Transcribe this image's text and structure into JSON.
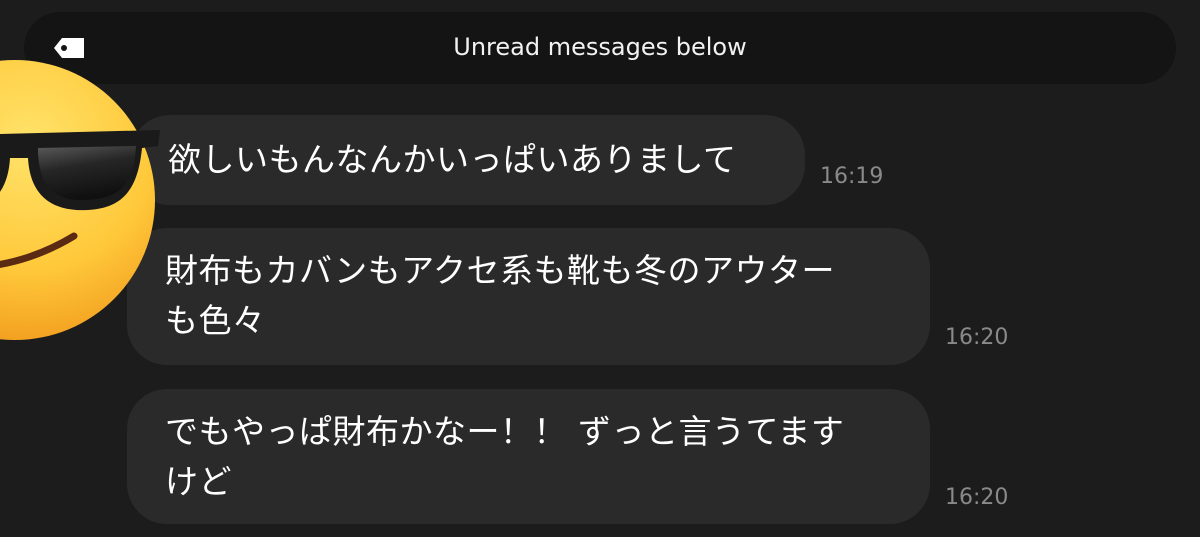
{
  "banner": {
    "text": "Unread messages below",
    "icon": "tag-icon"
  },
  "avatar": {
    "icon": "smiling-face-with-sunglasses-emoji"
  },
  "messages": [
    {
      "lines": [
        "欲しいもんなんかいっぱいありまして"
      ],
      "time": "16:19"
    },
    {
      "lines": [
        "財布もカバンもアクセ系も靴も冬のアウター",
        "も色々"
      ],
      "time": "16:20"
    },
    {
      "lines": [
        "でもやっぱ財布かなー！！ ずっと言うてます",
        "けど"
      ],
      "time": "16:20"
    }
  ],
  "colors": {
    "background": "#1c1c1c",
    "banner": "#141414",
    "bubble": "#2a2a2a",
    "text": "#ffffff",
    "timestamp": "#8a8a8a"
  }
}
